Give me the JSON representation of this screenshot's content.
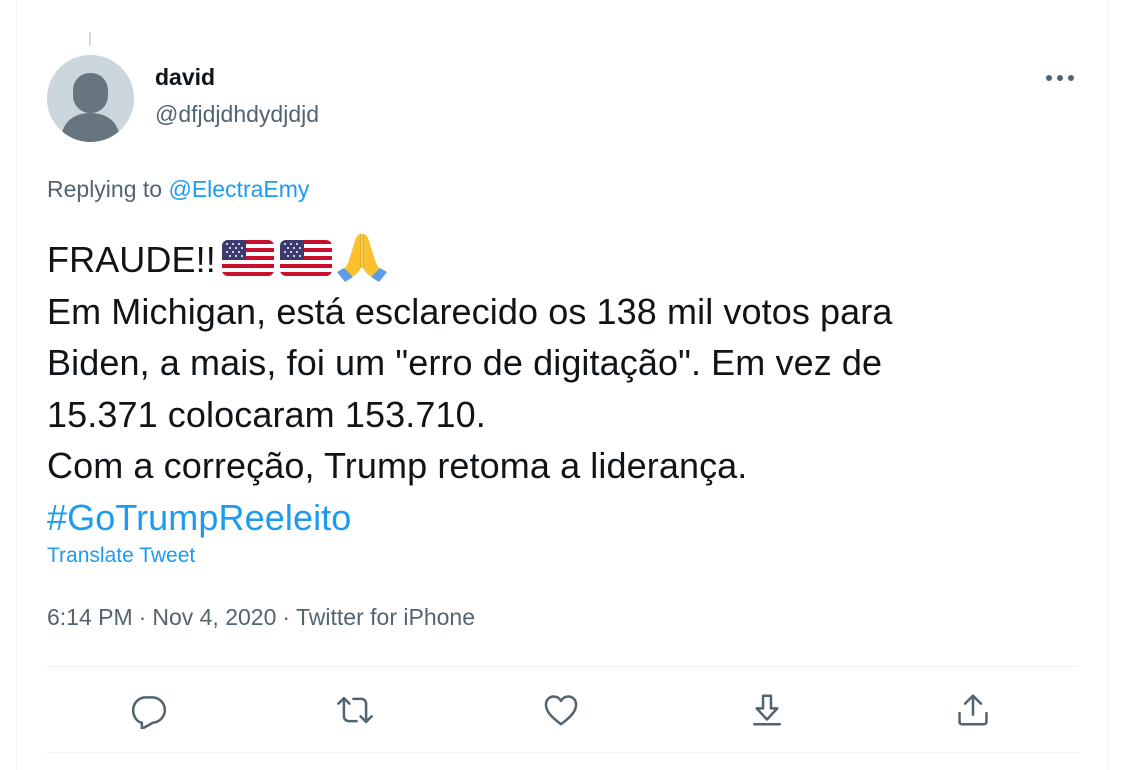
{
  "tweet": {
    "author": {
      "name": "david",
      "handle": "@dfjdjdhdydjdjd",
      "avatar_icon": "default-avatar-icon"
    },
    "replying": {
      "prefix": "Replying to",
      "mention": "@ElectraEmy"
    },
    "text": {
      "line1": "FRAUDE!!",
      "emojis": [
        "us-flag-icon",
        "us-flag-icon",
        "folded-hands-icon"
      ],
      "line2": "Em Michigan, está esclarecido os 138 mil votos para",
      "line3": "Biden, a mais, foi um \"erro de digitação\". Em vez de",
      "line4": "15.371 colocaram 153.710.",
      "line5": "Com a correção, Trump retoma a liderança.",
      "hashtag": "#GoTrumpReeleito"
    },
    "translate": "Translate Tweet",
    "meta": {
      "time": "6:14 PM",
      "separator": "·",
      "date": "Nov 4, 2020",
      "source": "Twitter for iPhone"
    },
    "actions": [
      {
        "name": "reply",
        "icon": "reply-icon"
      },
      {
        "name": "retweet",
        "icon": "retweet-icon"
      },
      {
        "name": "like",
        "icon": "heart-icon"
      },
      {
        "name": "save",
        "icon": "download-icon"
      },
      {
        "name": "share",
        "icon": "share-icon"
      }
    ]
  },
  "colors": {
    "accent": "#1d9bf0",
    "text": "#0f1419",
    "secondary": "#536471",
    "border": "#eff3f4"
  }
}
